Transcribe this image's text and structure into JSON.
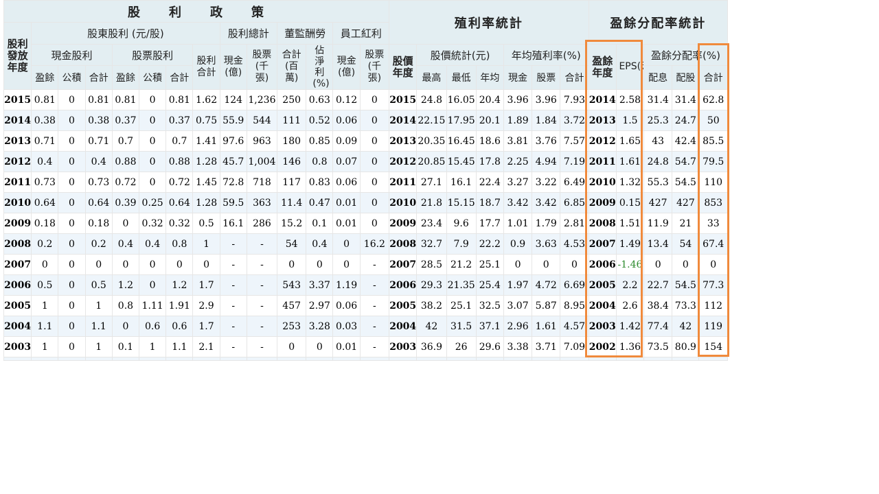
{
  "headers": {
    "policy_title": "股　　利　　政　　策",
    "yield_title": "殖利率統計",
    "payout_title": "盈餘分配率統計",
    "dist_year": "股利發放年度",
    "shareholder_div": "股東股利 (元/股)",
    "div_total_group": "股利總計",
    "director_pay": "董監酬勞",
    "employee_bonus": "員工紅利",
    "cash_div": "現金股利",
    "stock_div": "股票股利",
    "div_sum": "股利合計",
    "cash_total": "現金(億)",
    "stock_total": "股票(千張)",
    "director_sum": "合計(百萬)",
    "director_ratio": "佔淨利(%)",
    "emp_cash": "現金(億)",
    "emp_stock": "股票(千張)",
    "price_year": "股價年度",
    "price_stats": "股價統計(元)",
    "avg_yield": "年均殖利率(%)",
    "earn_year": "盈餘年度",
    "eps": "EPS(元)",
    "payout_ratio": "盈餘分配率(%)",
    "sub_earnings": "盈餘",
    "sub_reserve": "公積",
    "sub_total": "合計",
    "sub_high": "最高",
    "sub_low": "最低",
    "sub_avg": "年均",
    "sub_cash": "現金",
    "sub_stock": "股票",
    "sub_dist": "配息",
    "sub_stockdist": "配股"
  },
  "rows": [
    [
      "2015",
      "0.81",
      "0",
      "0.81",
      "0.81",
      "0",
      "0.81",
      "1.62",
      "124",
      "1,236",
      "250",
      "0.63",
      "0.12",
      "0",
      "2015",
      "24.8",
      "16.05",
      "20.4",
      "3.96",
      "3.96",
      "7.93",
      "2014",
      "2.58",
      "31.4",
      "31.4",
      "62.8"
    ],
    [
      "2014",
      "0.38",
      "0",
      "0.38",
      "0.37",
      "0",
      "0.37",
      "0.75",
      "55.9",
      "544",
      "111",
      "0.52",
      "0.06",
      "0",
      "2014",
      "22.15",
      "17.95",
      "20.1",
      "1.89",
      "1.84",
      "3.72",
      "2013",
      "1.5",
      "25.3",
      "24.7",
      "50"
    ],
    [
      "2013",
      "0.71",
      "0",
      "0.71",
      "0.7",
      "0",
      "0.7",
      "1.41",
      "97.6",
      "963",
      "180",
      "0.85",
      "0.09",
      "0",
      "2013",
      "20.35",
      "16.45",
      "18.6",
      "3.81",
      "3.76",
      "7.57",
      "2012",
      "1.65",
      "43",
      "42.4",
      "85.5"
    ],
    [
      "2012",
      "0.4",
      "0",
      "0.4",
      "0.88",
      "0",
      "0.88",
      "1.28",
      "45.7",
      "1,004",
      "146",
      "0.8",
      "0.07",
      "0",
      "2012",
      "20.85",
      "15.45",
      "17.8",
      "2.25",
      "4.94",
      "7.19",
      "2011",
      "1.61",
      "24.8",
      "54.7",
      "79.5"
    ],
    [
      "2011",
      "0.73",
      "0",
      "0.73",
      "0.72",
      "0",
      "0.72",
      "1.45",
      "72.8",
      "718",
      "117",
      "0.83",
      "0.06",
      "0",
      "2011",
      "27.1",
      "16.1",
      "22.4",
      "3.27",
      "3.22",
      "6.49",
      "2010",
      "1.32",
      "55.3",
      "54.5",
      "110"
    ],
    [
      "2010",
      "0.64",
      "0",
      "0.64",
      "0.39",
      "0.25",
      "0.64",
      "1.28",
      "59.5",
      "363",
      "11.4",
      "0.47",
      "0.01",
      "0",
      "2010",
      "21.8",
      "15.15",
      "18.7",
      "3.42",
      "3.42",
      "6.85",
      "2009",
      "0.15",
      "427",
      "427",
      "853"
    ],
    [
      "2009",
      "0.18",
      "0",
      "0.18",
      "0",
      "0.32",
      "0.32",
      "0.5",
      "16.1",
      "286",
      "15.2",
      "0.1",
      "0.01",
      "0",
      "2009",
      "23.4",
      "9.6",
      "17.7",
      "1.01",
      "1.79",
      "2.81",
      "2008",
      "1.51",
      "11.9",
      "21",
      "33"
    ],
    [
      "2008",
      "0.2",
      "0",
      "0.2",
      "0.4",
      "0.4",
      "0.8",
      "1",
      "-",
      "-",
      "54",
      "0.4",
      "0",
      "16.2",
      "2008",
      "32.7",
      "7.9",
      "22.2",
      "0.9",
      "3.63",
      "4.53",
      "2007",
      "1.49",
      "13.4",
      "54",
      "67.4"
    ],
    [
      "2007",
      "0",
      "0",
      "0",
      "0",
      "0",
      "0",
      "0",
      "-",
      "-",
      "0",
      "0",
      "0",
      "-",
      "2007",
      "28.5",
      "21.2",
      "25.1",
      "0",
      "0",
      "0",
      "2006",
      "-1.46",
      "0",
      "0",
      "0"
    ],
    [
      "2006",
      "0.5",
      "0",
      "0.5",
      "1.2",
      "0",
      "1.2",
      "1.7",
      "-",
      "-",
      "543",
      "3.37",
      "1.19",
      "-",
      "2006",
      "29.3",
      "21.35",
      "25.4",
      "1.97",
      "4.72",
      "6.69",
      "2005",
      "2.2",
      "22.7",
      "54.5",
      "77.3"
    ],
    [
      "2005",
      "1",
      "0",
      "1",
      "0.8",
      "1.11",
      "1.91",
      "2.9",
      "-",
      "-",
      "457",
      "2.97",
      "0.06",
      "-",
      "2005",
      "38.2",
      "25.1",
      "32.5",
      "3.07",
      "5.87",
      "8.95",
      "2004",
      "2.6",
      "38.4",
      "73.3",
      "112"
    ],
    [
      "2004",
      "1.1",
      "0",
      "1.1",
      "0",
      "0.6",
      "0.6",
      "1.7",
      "-",
      "-",
      "253",
      "3.28",
      "0.03",
      "-",
      "2004",
      "42",
      "31.5",
      "37.1",
      "2.96",
      "1.61",
      "4.57",
      "2003",
      "1.42",
      "77.4",
      "42",
      "119"
    ],
    [
      "2003",
      "1",
      "0",
      "1",
      "0.1",
      "1",
      "1.1",
      "2.1",
      "-",
      "-",
      "0",
      "0",
      "0.01",
      "-",
      "2003",
      "36.9",
      "26",
      "29.6",
      "3.38",
      "3.71",
      "7.09",
      "2002",
      "1.36",
      "73.5",
      "80.9",
      "154"
    ]
  ],
  "colors": {
    "header_bg": "#e3eef2",
    "stripe_bg": "#eef5fb",
    "highlight": "#f08a3c",
    "negative": "#2e8b2e"
  }
}
